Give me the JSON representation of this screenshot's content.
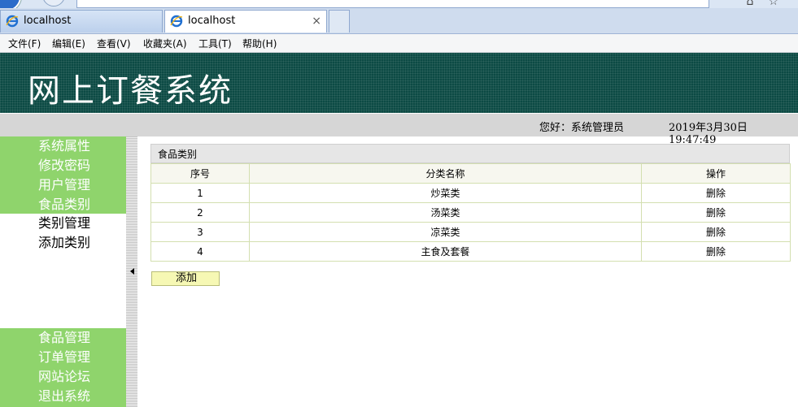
{
  "browser": {
    "tabs": [
      {
        "label": "localhost"
      },
      {
        "label": "localhost",
        "close": "×"
      }
    ],
    "menu": [
      "文件(F)",
      "编辑(E)",
      "查看(V)",
      "收藏夹(A)",
      "工具(T)",
      "帮助(H)"
    ]
  },
  "header": {
    "title": "网上订餐系统",
    "greeting": "您好：系统管理员",
    "datetime": "2019年3月30日 19:47:49"
  },
  "sidebar": {
    "top_items": [
      {
        "label": "系统属性"
      },
      {
        "label": "修改密码"
      },
      {
        "label": "用户管理"
      },
      {
        "label": "食品类别"
      }
    ],
    "sub_items": [
      {
        "label": "类别管理"
      },
      {
        "label": "添加类别"
      }
    ],
    "bottom_items": [
      {
        "label": "食品管理"
      },
      {
        "label": "订单管理"
      },
      {
        "label": "网站论坛"
      },
      {
        "label": "退出系统"
      }
    ]
  },
  "content": {
    "panel_title": "食品类别",
    "columns": [
      "序号",
      "分类名称",
      "操作"
    ],
    "rows": [
      {
        "id": "1",
        "name": "炒菜类",
        "action": "删除"
      },
      {
        "id": "2",
        "name": "汤菜类",
        "action": "删除"
      },
      {
        "id": "3",
        "name": "凉菜类",
        "action": "删除"
      },
      {
        "id": "4",
        "name": "主食及套餐",
        "action": "删除"
      }
    ],
    "add_label": "添加"
  },
  "colors": {
    "header_bg": "#0c4a44",
    "nav_green": "#8fd46c",
    "button_yellow": "#f6f8b4"
  }
}
